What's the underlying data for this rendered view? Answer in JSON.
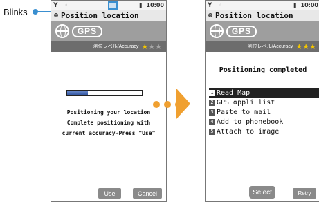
{
  "callout": {
    "label": "Blinks"
  },
  "left_screen": {
    "status": {
      "antenna": "Y",
      "clock": "10:00",
      "battery": "▮"
    },
    "title": "Position location",
    "logo_text": "GPS",
    "accuracy_label": "測位レベル/Accuracy",
    "accuracy_stars_filled": 1,
    "accuracy_stars_total": 3,
    "progress_fraction": 0.28,
    "message_lines": [
      "Positioning your location",
      "Complete positioning with",
      "current accuracy→Press \"Use\""
    ],
    "softkeys": {
      "use": "Use",
      "cancel": "Cancel"
    }
  },
  "right_screen": {
    "status": {
      "antenna": "Y",
      "clock": "10:00"
    },
    "title": "Position location",
    "logo_text": "GPS",
    "accuracy_label": "測位レベル/Accuracy",
    "accuracy_stars_filled": 3,
    "accuracy_stars_total": 3,
    "status_text": "Positioning completed",
    "menu": [
      {
        "num": "1",
        "label": "Read Map",
        "selected": true
      },
      {
        "num": "2",
        "label": "GPS αppli list",
        "selected": false
      },
      {
        "num": "3",
        "label": "Paste to mail",
        "selected": false
      },
      {
        "num": "4",
        "label": "Add to phonebook",
        "selected": false
      },
      {
        "num": "5",
        "label": "Attach to image",
        "selected": false
      }
    ],
    "softkeys": {
      "select": "Select",
      "retry": "Retry"
    }
  },
  "colors": {
    "accent_blue": "#3a8fd0",
    "arrow_orange": "#f0a030",
    "star_gold": "#f2c400"
  }
}
